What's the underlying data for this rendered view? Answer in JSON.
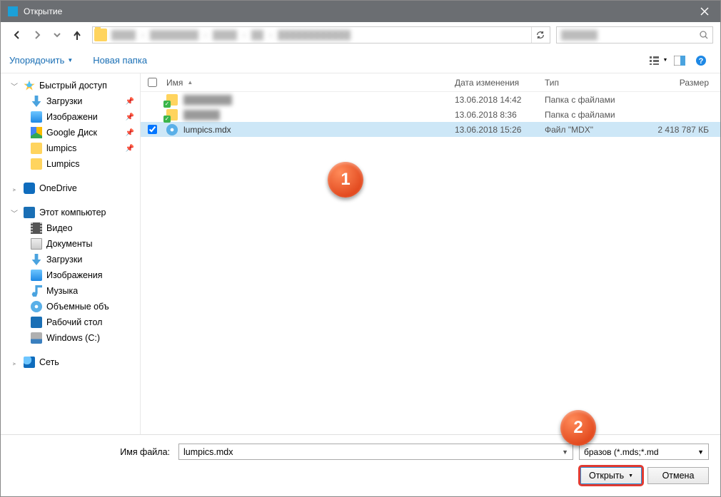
{
  "title": "Открытие",
  "toolbar": {
    "organize": "Упорядочить",
    "newfolder": "Новая папка"
  },
  "columns": {
    "name": "Имя",
    "date": "Дата изменения",
    "type": "Тип",
    "size": "Размер"
  },
  "sidebar": {
    "quickaccess": "Быстрый доступ",
    "downloads": "Загрузки",
    "pictures": "Изображени",
    "gdrive": "Google Диск",
    "lumpics": "lumpics",
    "lumpics2": "Lumpics",
    "onedrive": "OneDrive",
    "thispc": "Этот компьютер",
    "video": "Видео",
    "documents": "Документы",
    "downloads2": "Загрузки",
    "pictures2": "Изображения",
    "music": "Музыка",
    "volumes": "Объемные объ",
    "desktop": "Рабочий стол",
    "cdrive": "Windows (C:)",
    "network": "Сеть"
  },
  "files": [
    {
      "name": "",
      "date": "13.06.2018 14:42",
      "type": "Папка с файлами",
      "size": ""
    },
    {
      "name": "",
      "date": "13.06.2018 8:36",
      "type": "Папка с файлами",
      "size": ""
    },
    {
      "name": "lumpics.mdx",
      "date": "13.06.2018 15:26",
      "type": "Файл \"MDX\"",
      "size": "2 418 787 КБ"
    }
  ],
  "footer": {
    "fnlabel": "Имя файла:",
    "filename": "lumpics.mdx",
    "filter": "бразов (*.mds;*.md",
    "open": "Открыть",
    "cancel": "Отмена"
  },
  "callouts": {
    "one": "1",
    "two": "2"
  }
}
